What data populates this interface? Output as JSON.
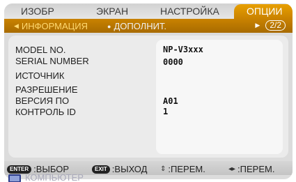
{
  "tabs": [
    {
      "label": "ИЗОБР"
    },
    {
      "label": "ЭКРАН"
    },
    {
      "label": "НАСТРОЙКА"
    },
    {
      "label": "ОПЦИИ"
    }
  ],
  "subtabs": [
    {
      "label": "ИНФОРМАЦИЯ"
    },
    {
      "label": "ДОПОЛНИТ."
    }
  ],
  "page_indicator": "2/2",
  "info": {
    "model_label": "MODEL NO.",
    "model_value": "NP-V3xxx",
    "serial_label": "SERIAL NUMBER",
    "serial_value": "0000",
    "source_label": "ИСТОЧНИК",
    "resolution_label": "РАЗРЕШЕНИЕ",
    "version_label": "ВЕРСИЯ ПО",
    "version_value": "A01",
    "control_id_label": "КОНТРОЛЬ ID",
    "control_id_value": "1"
  },
  "help": {
    "enter_key": "ENTER",
    "enter_label": ":ВЫБОР",
    "exit_key": "EXIT",
    "exit_label": ":ВЫХОД",
    "updown_label": ":ПЕРЕМ.",
    "leftright_label": ":ПЕРЕМ."
  },
  "source_strip": {
    "label": "КОМПЬЮТЕР"
  },
  "colors": {
    "accent": "#d08a00",
    "background": "#dcdcdc"
  }
}
